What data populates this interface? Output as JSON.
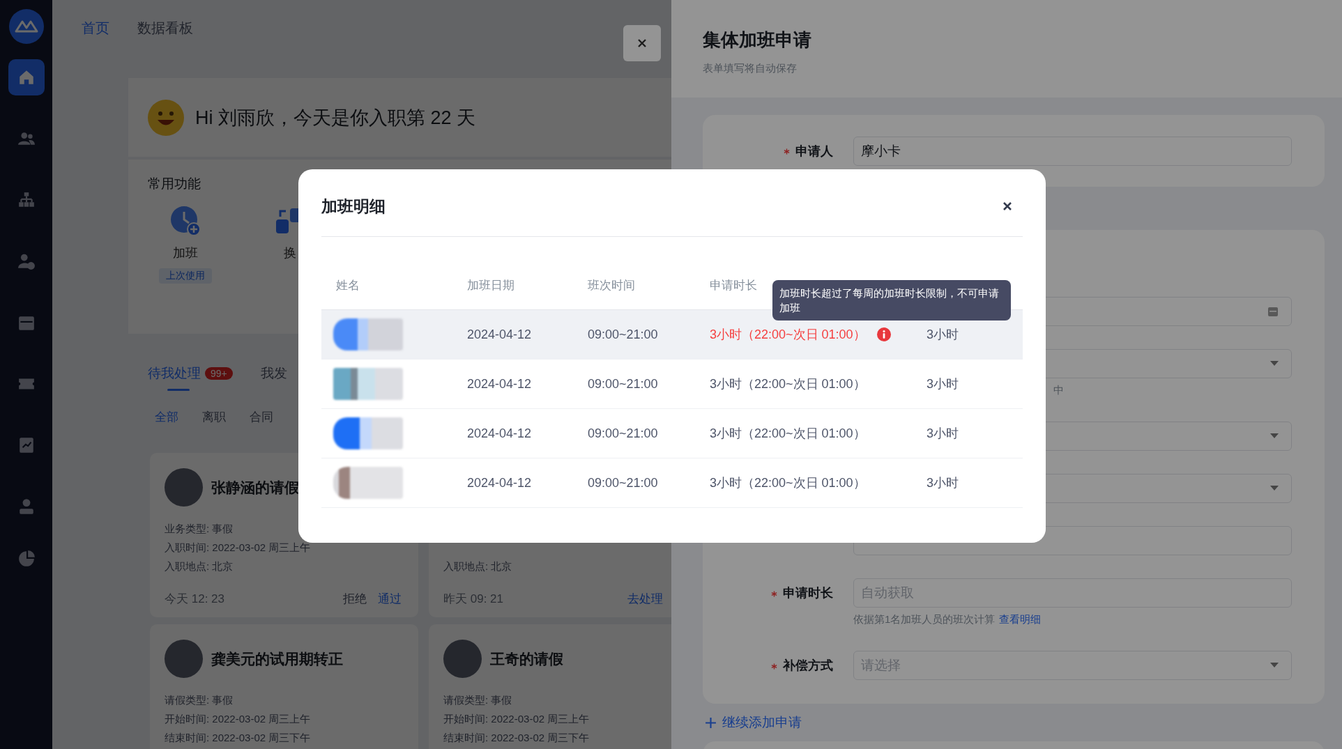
{
  "sidebar": {
    "items": [
      {
        "selected": true
      },
      {
        "selected": false
      },
      {
        "selected": false
      },
      {
        "selected": false
      },
      {
        "selected": false
      },
      {
        "selected": false
      },
      {
        "selected": false
      },
      {
        "selected": false
      }
    ]
  },
  "top_tabs": [
    {
      "label": "首页",
      "selected": true
    },
    {
      "label": "数据看板",
      "selected": false
    }
  ],
  "greeting": "Hi 刘雨欣，今天是你入职第 22 天",
  "shortcuts": {
    "title": "常用功能",
    "items": [
      {
        "label": "加班",
        "tag": "上次使用"
      },
      {
        "label": "换"
      }
    ]
  },
  "task_tabs": [
    {
      "label": "待我处理",
      "badge": "99+",
      "selected": true
    },
    {
      "label": "我发",
      "selected": false
    }
  ],
  "filters": [
    {
      "label": "全部",
      "selected": true
    },
    {
      "label": "离职",
      "selected": false
    },
    {
      "label": "合同",
      "selected": false
    }
  ],
  "cards": [
    {
      "title": "张静涵的请假",
      "lines": [
        "业务类型: 事假",
        "入职时间: 2022-03-02 周三上午",
        "入职地点: 北京"
      ],
      "time": "今天 12: 23",
      "actions": [
        {
          "label": "拒绝",
          "kind": "plain"
        },
        {
          "label": "通过",
          "kind": "primary"
        }
      ]
    },
    {
      "lines": [
        "入职地点: 北京"
      ],
      "time": "昨天 09: 21",
      "actions": [
        {
          "label": "去处理",
          "kind": "primary"
        }
      ]
    },
    {
      "title": "龚美元的试用期转正",
      "lines": [
        "请假类型: 事假",
        "开始时间: 2022-03-02 周三上午",
        "结束时间: 2022-03-02 周三下午"
      ]
    },
    {
      "title": "王奇的请假",
      "lines": [
        "请假类型: 事假",
        "开始时间: 2022-03-02 周三上午",
        "结束时间: 2022-03-02 周三下午"
      ]
    }
  ],
  "drawer": {
    "title": "集体加班申请",
    "subtitle": "表单填写将自动保存",
    "applicant": {
      "label": "申请人",
      "required": true,
      "value": "摩小卡"
    },
    "fields": [
      {
        "kind": "date"
      },
      {
        "kind": "select",
        "hint": "中"
      },
      {
        "kind": "select"
      },
      {
        "kind": "select"
      },
      {
        "kind": "text"
      },
      {
        "kind": "text",
        "label": "申请时长",
        "required": true,
        "placeholder": "自动获取",
        "hint": "依据第1名加班人员的班次计算",
        "link": "查看明细"
      },
      {
        "kind": "select",
        "label": "补偿方式",
        "required": true,
        "placeholder": "请选择"
      }
    ],
    "add_link": "继续添加申请"
  },
  "modal": {
    "title": "加班明细",
    "columns": [
      "姓名",
      "加班日期",
      "班次时间",
      "申请时长"
    ],
    "tooltip": "加班时长超过了每周的加班时长限制，不可申请加班",
    "rows": [
      {
        "date": "2024-04-12",
        "shift": "09:00~21:00",
        "duration": "3小时（22:00~次日 01:00）",
        "exceeded": true,
        "highlighted": true,
        "column_5": "3小时"
      },
      {
        "date": "2024-04-12",
        "shift": "09:00~21:00",
        "duration": "3小时（22:00~次日 01:00）",
        "exceeded": false,
        "highlighted": false,
        "column_5": "3小时"
      },
      {
        "date": "2024-04-12",
        "shift": "09:00~21:00",
        "duration": "3小时（22:00~次日 01:00）",
        "exceeded": false,
        "highlighted": false,
        "column_5": "3小时"
      },
      {
        "date": "2024-04-12",
        "shift": "09:00~21:00",
        "duration": "3小时（22:00~次日 01:00）",
        "exceeded": false,
        "highlighted": false,
        "column_5": "3小时"
      }
    ]
  }
}
